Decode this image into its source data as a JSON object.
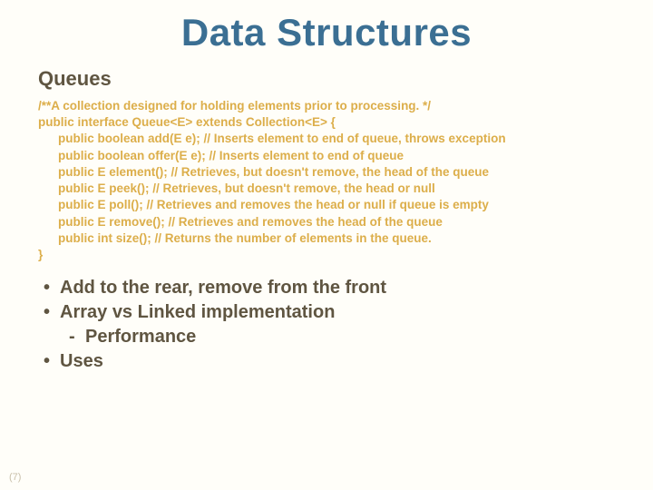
{
  "title": "Data Structures",
  "subtitle": "Queues",
  "code": {
    "comment": "/**A collection designed for holding elements prior to processing. */",
    "decl": "public interface Queue<E> extends Collection<E> {",
    "lines": [
      "public boolean add(E e); // Inserts element to end of queue, throws exception",
      "public boolean offer(E e); // Inserts element to end of queue",
      "public E element(); // Retrieves, but doesn't remove, the head of the queue",
      "public E peek(); // Retrieves, but doesn't remove, the head or null",
      "public E poll(); // Retrieves and removes the head or null if queue is empty",
      "public E remove();  // Retrieves and removes the head of the queue",
      "public int size(); // Returns the number of elements in the queue."
    ],
    "close": "}"
  },
  "bullets": {
    "0": "Add to the rear, remove from the front",
    "1": "Array vs Linked implementation",
    "sub0": "Performance",
    "2": "Uses"
  },
  "page": "(7)"
}
